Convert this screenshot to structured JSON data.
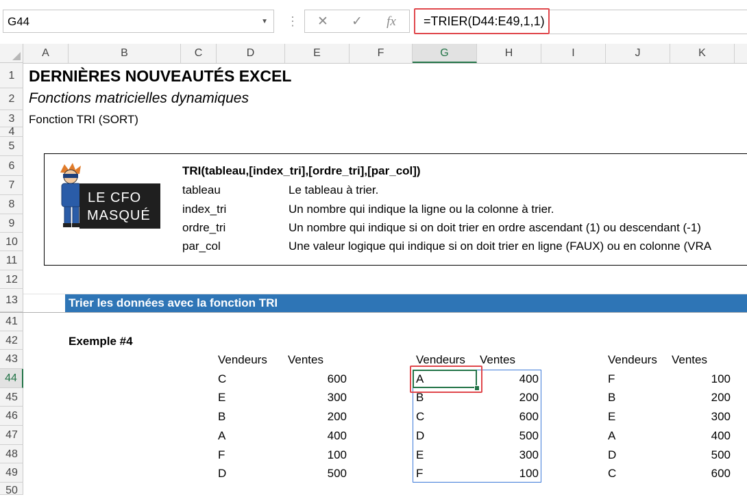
{
  "formula_bar": {
    "name_box": "G44",
    "cancel_icon": "✕",
    "enter_icon": "✓",
    "fx_label": "fx",
    "formula": "=TRIER(D44:E49,1,1)"
  },
  "columns": [
    "A",
    "B",
    "C",
    "D",
    "E",
    "F",
    "G",
    "H",
    "I",
    "J",
    "K"
  ],
  "rows": [
    "1",
    "2",
    "3",
    "4",
    "5",
    "6",
    "7",
    "8",
    "9",
    "10",
    "11",
    "12",
    "13",
    "41",
    "42",
    "43",
    "44",
    "45",
    "46",
    "47",
    "48",
    "49",
    "50"
  ],
  "selected": {
    "column": "G",
    "row": "44"
  },
  "doc": {
    "title": "DERNIÈRES NOUVEAUTÉS EXCEL",
    "subtitle": "Fonctions matricielles dynamiques",
    "function_label": "Fonction TRI (SORT)"
  },
  "logo": {
    "line1": "LE CFO",
    "line2": "MASQUÉ"
  },
  "syntax": {
    "signature": "TRI(tableau,[index_tri],[ordre_tri],[par_col])",
    "params": [
      {
        "name": "tableau",
        "desc": "Le tableau à trier."
      },
      {
        "name": "index_tri",
        "desc": "Un nombre qui indique la ligne ou la colonne à trier."
      },
      {
        "name": "ordre_tri",
        "desc": "Un nombre qui indique si on doit trier en ordre ascendant (1) ou descendant (-1)"
      },
      {
        "name": "par_col",
        "desc": "Une valeur logique qui indique si on doit trier en ligne (FAUX) ou en colonne (VRA"
      }
    ]
  },
  "section_title": "Trier les données avec la fonction TRI",
  "example_label": "Exemple #4",
  "tables": [
    {
      "h1": "Vendeurs",
      "h2": "Ventes",
      "rows": [
        [
          "C",
          "600"
        ],
        [
          "E",
          "300"
        ],
        [
          "B",
          "200"
        ],
        [
          "A",
          "400"
        ],
        [
          "F",
          "100"
        ],
        [
          "D",
          "500"
        ]
      ]
    },
    {
      "h1": "Vendeurs",
      "h2": "Ventes",
      "rows": [
        [
          "A",
          "400"
        ],
        [
          "B",
          "200"
        ],
        [
          "C",
          "600"
        ],
        [
          "D",
          "500"
        ],
        [
          "E",
          "300"
        ],
        [
          "F",
          "100"
        ]
      ]
    },
    {
      "h1": "Vendeurs",
      "h2": "Ventes",
      "rows": [
        [
          "F",
          "100"
        ],
        [
          "B",
          "200"
        ],
        [
          "E",
          "300"
        ],
        [
          "A",
          "400"
        ],
        [
          "D",
          "500"
        ],
        [
          "C",
          "600"
        ]
      ]
    }
  ]
}
